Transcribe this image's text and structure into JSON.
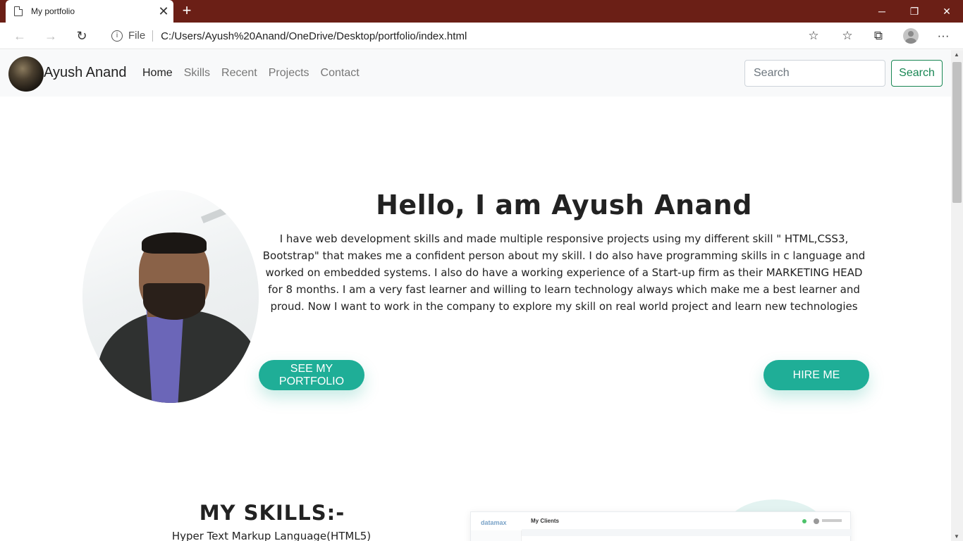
{
  "browser": {
    "tab_title": "My portfolio",
    "tab_close": "✕",
    "new_tab": "+",
    "window_controls": {
      "minimize": "─",
      "restore": "❐",
      "close": "✕"
    },
    "back": "←",
    "forward": "→",
    "reload": "↻",
    "site_info": "i",
    "file_label": "File",
    "url": "C:/Users/Ayush%20Anand/OneDrive/Desktop/portfolio/index.html",
    "add_favorite": "☆",
    "favorites": "☆",
    "collections": "⧉",
    "more": "···"
  },
  "site": {
    "brand": "Ayush Anand",
    "nav": [
      "Home",
      "Skills",
      "Recent",
      "Projects",
      "Contact"
    ],
    "search_placeholder": "Search",
    "search_button": "Search"
  },
  "hero": {
    "heading": "Hello, I am Ayush Anand",
    "text": "I have web development skills and made multiple responsive projects using my different skill \" HTML,CSS3, Bootstrap\" that makes me a confident person about my skill. I do also have programming skills in c language and worked on embedded systems. I also do have a working experience of a Start-up firm as their MARKETING HEAD for 8 months. I am a very fast learner and willing to learn technology always which make me a best learner and proud. Now I want to work in the company to explore my skill on real world project and learn new technologies",
    "portfolio_button": "SEE MY PORTFOLIO",
    "hire_button": "HIRE ME"
  },
  "skills": {
    "heading": "MY SKILLS:-",
    "first_item": "Hyper Text Markup Language(HTML5)"
  },
  "mockup": {
    "logo": "datamax",
    "title": "My Clients"
  },
  "scrollbar": {
    "up": "▲",
    "down": "▼"
  }
}
